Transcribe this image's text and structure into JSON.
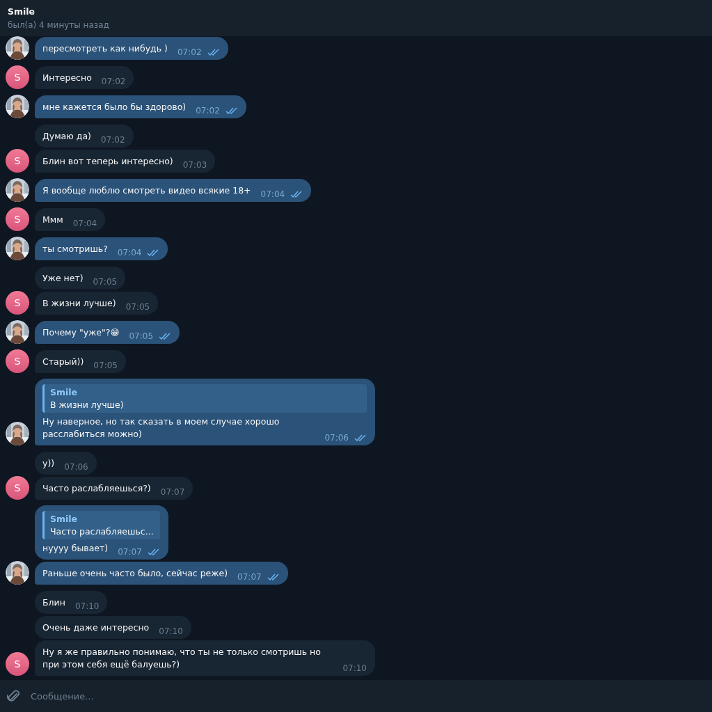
{
  "header": {
    "name": "Smile",
    "status": "был(а) 4 минуты назад"
  },
  "messages": [
    {
      "kind": "outgoing",
      "text": "пересмотреть как нибудь )",
      "time": "07:02",
      "read": true,
      "avatar": true
    },
    {
      "kind": "incoming",
      "text": "Интересно",
      "time": "07:02",
      "avatar_initial": "S"
    },
    {
      "kind": "outgoing",
      "text": "мне кажется было бы здорово)",
      "time": "07:02",
      "read": true,
      "avatar": true
    },
    {
      "kind": "incoming",
      "text": "Думаю да)",
      "time": "07:02"
    },
    {
      "kind": "incoming",
      "text": "Блин вот теперь интересно)",
      "time": "07:03",
      "avatar_initial": "S"
    },
    {
      "kind": "outgoing",
      "text": "Я вообще люблю смотреть видео всякие 18+",
      "time": "07:04",
      "read": true,
      "avatar": true
    },
    {
      "kind": "incoming",
      "text": "Ммм",
      "time": "07:04",
      "avatar_initial": "S"
    },
    {
      "kind": "outgoing",
      "text": "ты смотришь?",
      "time": "07:04",
      "read": true,
      "avatar": true
    },
    {
      "kind": "incoming",
      "text": "Уже нет)",
      "time": "07:05"
    },
    {
      "kind": "incoming",
      "text": "В жизни лучше)",
      "time": "07:05",
      "avatar_initial": "S"
    },
    {
      "kind": "outgoing",
      "text": "Почему \"уже\"?😁",
      "time": "07:05",
      "read": true,
      "avatar": true
    },
    {
      "kind": "incoming",
      "text": "Старый))",
      "time": "07:05",
      "avatar_initial": "S"
    },
    {
      "kind": "outgoing",
      "reply": {
        "author": "Smile",
        "text": "В жизни лучше)"
      },
      "text": "Ну наверное, но так сказать в моем случае хорошо расслабиться можно)",
      "time": "07:06",
      "read": true,
      "avatar": true
    },
    {
      "kind": "incoming",
      "text": "у))",
      "time": "07:06"
    },
    {
      "kind": "incoming",
      "text": "Часто раслабляешься?)",
      "time": "07:07",
      "avatar_initial": "S"
    },
    {
      "kind": "outgoing",
      "reply": {
        "author": "Smile",
        "text": "Часто раслабляешьс..."
      },
      "text": "нуууу бывает)",
      "time": "07:07",
      "read": true,
      "avatar": false
    },
    {
      "kind": "outgoing",
      "text": "Раньше очень часто было, сейчас реже)",
      "time": "07:07",
      "read": true,
      "avatar": true
    },
    {
      "kind": "incoming",
      "text": "Блин",
      "time": "07:10"
    },
    {
      "kind": "incoming",
      "text": "Очень даже интересно",
      "time": "07:10"
    },
    {
      "kind": "incoming",
      "text": "Ну я же правильно понимаю, что ты не только смотришь но при этом себя ещё балуешь?)",
      "time": "07:10",
      "avatar_initial": "S"
    }
  ],
  "composer": {
    "placeholder": "Сообщение..."
  }
}
